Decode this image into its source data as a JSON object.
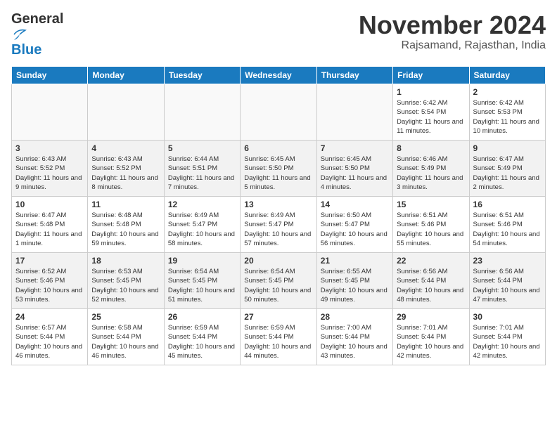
{
  "header": {
    "logo_line1_general": "General",
    "logo_line2_blue": "Blue",
    "month_title": "November 2024",
    "location": "Rajsamand, Rajasthan, India"
  },
  "days_of_week": [
    "Sunday",
    "Monday",
    "Tuesday",
    "Wednesday",
    "Thursday",
    "Friday",
    "Saturday"
  ],
  "weeks": [
    [
      {
        "day": "",
        "info": ""
      },
      {
        "day": "",
        "info": ""
      },
      {
        "day": "",
        "info": ""
      },
      {
        "day": "",
        "info": ""
      },
      {
        "day": "",
        "info": ""
      },
      {
        "day": "1",
        "info": "Sunrise: 6:42 AM\nSunset: 5:54 PM\nDaylight: 11 hours and 11 minutes."
      },
      {
        "day": "2",
        "info": "Sunrise: 6:42 AM\nSunset: 5:53 PM\nDaylight: 11 hours and 10 minutes."
      }
    ],
    [
      {
        "day": "3",
        "info": "Sunrise: 6:43 AM\nSunset: 5:52 PM\nDaylight: 11 hours and 9 minutes."
      },
      {
        "day": "4",
        "info": "Sunrise: 6:43 AM\nSunset: 5:52 PM\nDaylight: 11 hours and 8 minutes."
      },
      {
        "day": "5",
        "info": "Sunrise: 6:44 AM\nSunset: 5:51 PM\nDaylight: 11 hours and 7 minutes."
      },
      {
        "day": "6",
        "info": "Sunrise: 6:45 AM\nSunset: 5:50 PM\nDaylight: 11 hours and 5 minutes."
      },
      {
        "day": "7",
        "info": "Sunrise: 6:45 AM\nSunset: 5:50 PM\nDaylight: 11 hours and 4 minutes."
      },
      {
        "day": "8",
        "info": "Sunrise: 6:46 AM\nSunset: 5:49 PM\nDaylight: 11 hours and 3 minutes."
      },
      {
        "day": "9",
        "info": "Sunrise: 6:47 AM\nSunset: 5:49 PM\nDaylight: 11 hours and 2 minutes."
      }
    ],
    [
      {
        "day": "10",
        "info": "Sunrise: 6:47 AM\nSunset: 5:48 PM\nDaylight: 11 hours and 1 minute."
      },
      {
        "day": "11",
        "info": "Sunrise: 6:48 AM\nSunset: 5:48 PM\nDaylight: 10 hours and 59 minutes."
      },
      {
        "day": "12",
        "info": "Sunrise: 6:49 AM\nSunset: 5:47 PM\nDaylight: 10 hours and 58 minutes."
      },
      {
        "day": "13",
        "info": "Sunrise: 6:49 AM\nSunset: 5:47 PM\nDaylight: 10 hours and 57 minutes."
      },
      {
        "day": "14",
        "info": "Sunrise: 6:50 AM\nSunset: 5:47 PM\nDaylight: 10 hours and 56 minutes."
      },
      {
        "day": "15",
        "info": "Sunrise: 6:51 AM\nSunset: 5:46 PM\nDaylight: 10 hours and 55 minutes."
      },
      {
        "day": "16",
        "info": "Sunrise: 6:51 AM\nSunset: 5:46 PM\nDaylight: 10 hours and 54 minutes."
      }
    ],
    [
      {
        "day": "17",
        "info": "Sunrise: 6:52 AM\nSunset: 5:46 PM\nDaylight: 10 hours and 53 minutes."
      },
      {
        "day": "18",
        "info": "Sunrise: 6:53 AM\nSunset: 5:45 PM\nDaylight: 10 hours and 52 minutes."
      },
      {
        "day": "19",
        "info": "Sunrise: 6:54 AM\nSunset: 5:45 PM\nDaylight: 10 hours and 51 minutes."
      },
      {
        "day": "20",
        "info": "Sunrise: 6:54 AM\nSunset: 5:45 PM\nDaylight: 10 hours and 50 minutes."
      },
      {
        "day": "21",
        "info": "Sunrise: 6:55 AM\nSunset: 5:45 PM\nDaylight: 10 hours and 49 minutes."
      },
      {
        "day": "22",
        "info": "Sunrise: 6:56 AM\nSunset: 5:44 PM\nDaylight: 10 hours and 48 minutes."
      },
      {
        "day": "23",
        "info": "Sunrise: 6:56 AM\nSunset: 5:44 PM\nDaylight: 10 hours and 47 minutes."
      }
    ],
    [
      {
        "day": "24",
        "info": "Sunrise: 6:57 AM\nSunset: 5:44 PM\nDaylight: 10 hours and 46 minutes."
      },
      {
        "day": "25",
        "info": "Sunrise: 6:58 AM\nSunset: 5:44 PM\nDaylight: 10 hours and 46 minutes."
      },
      {
        "day": "26",
        "info": "Sunrise: 6:59 AM\nSunset: 5:44 PM\nDaylight: 10 hours and 45 minutes."
      },
      {
        "day": "27",
        "info": "Sunrise: 6:59 AM\nSunset: 5:44 PM\nDaylight: 10 hours and 44 minutes."
      },
      {
        "day": "28",
        "info": "Sunrise: 7:00 AM\nSunset: 5:44 PM\nDaylight: 10 hours and 43 minutes."
      },
      {
        "day": "29",
        "info": "Sunrise: 7:01 AM\nSunset: 5:44 PM\nDaylight: 10 hours and 42 minutes."
      },
      {
        "day": "30",
        "info": "Sunrise: 7:01 AM\nSunset: 5:44 PM\nDaylight: 10 hours and 42 minutes."
      }
    ]
  ]
}
